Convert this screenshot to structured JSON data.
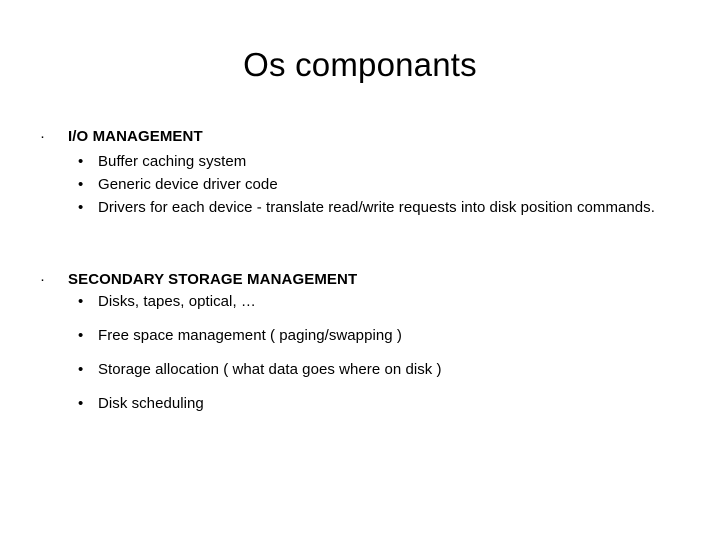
{
  "slide": {
    "title": "Os componants",
    "background_color": "#ffffff",
    "text_color": "#000000",
    "bullet_level1_glyph": "·",
    "bullet_level2_glyph": "•",
    "sections": [
      {
        "heading": "I/O MANAGEMENT",
        "items": [
          {
            "text": "Buffer caching system",
            "justified": false,
            "spaced": false
          },
          {
            "text": "Generic device driver code",
            "justified": false,
            "spaced": false
          },
          {
            "text": "Drivers for each device - translate read/write requests into disk position commands.",
            "justified": true,
            "spaced": false
          }
        ]
      },
      {
        "heading": "SECONDARY STORAGE MANAGEMENT",
        "items": [
          {
            "text": "Disks, tapes, optical, …",
            "justified": false,
            "spaced": false
          },
          {
            "text": "Free space management ( paging/swapping )",
            "justified": false,
            "spaced": true
          },
          {
            "text": "Storage allocation ( what data goes where on disk )",
            "justified": false,
            "spaced": true
          },
          {
            "text": "Disk scheduling",
            "justified": false,
            "spaced": true
          }
        ]
      }
    ]
  }
}
